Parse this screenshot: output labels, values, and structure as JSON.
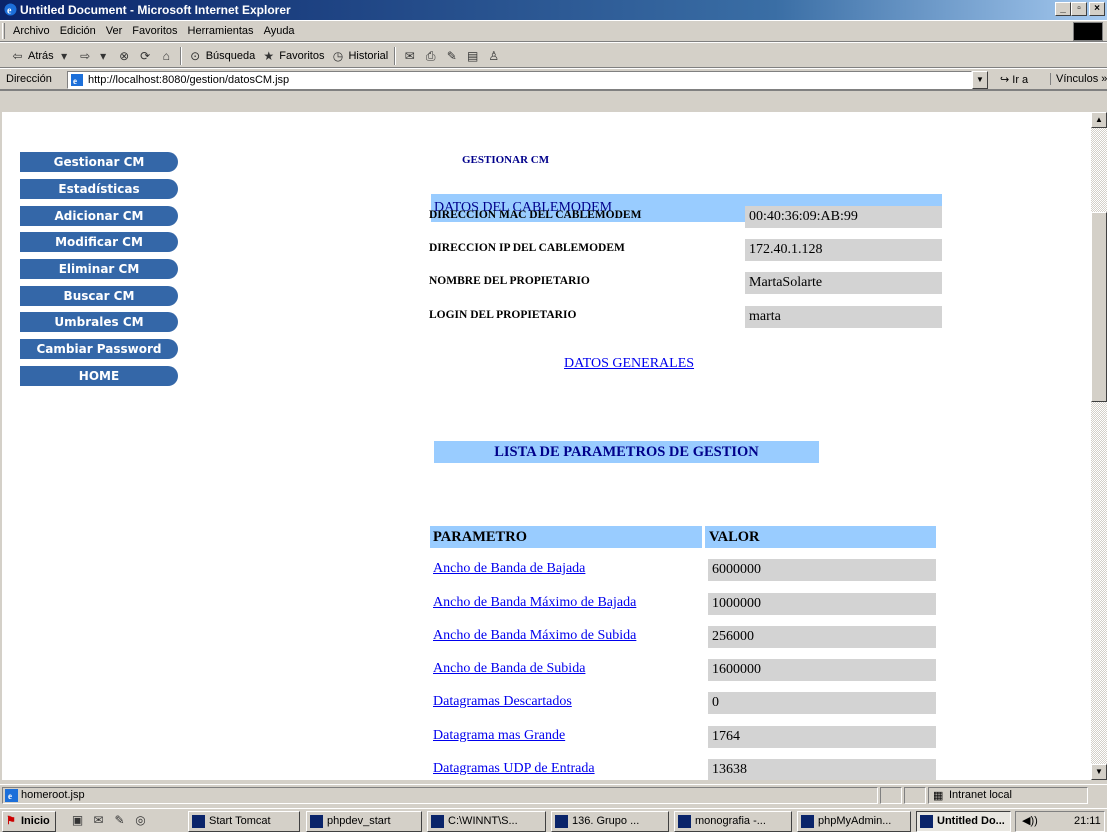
{
  "window": {
    "title": "Untitled Document - Microsoft Internet Explorer",
    "min": "_",
    "max": "á",
    "close": "×"
  },
  "menu": [
    "Archivo",
    "Edición",
    "Ver",
    "Favoritos",
    "Herramientas",
    "Ayuda"
  ],
  "toolbar": {
    "back": "Atrás",
    "search": "Búsqueda",
    "favorites": "Favoritos",
    "history": "Historial"
  },
  "address": {
    "label": "Dirección",
    "url": "http://localhost:8080/gestion/datosCM.jsp",
    "go": "Ir a",
    "links": "Vínculos"
  },
  "page": {
    "heading": "GESTIONAR CM",
    "nav": [
      "Gestionar CM",
      "Estadísticas",
      "Adicionar CM",
      "Modificar CM",
      "Eliminar CM",
      "Buscar CM",
      "Umbrales CM",
      "Cambiar Password",
      "HOME"
    ],
    "datos_title": "DATOS DEL CABLEMODEM",
    "datos": [
      {
        "label": "DIRECCION MAC DEL CABLEMODEM",
        "value": "00:40:36:09:AB:99"
      },
      {
        "label": "DIRECCION IP DEL CABLEMODEM",
        "value": "172.40.1.128"
      },
      {
        "label": "NOMBRE DEL PROPIETARIO",
        "value": "MartaSolarte"
      },
      {
        "label": "LOGIN DEL PROPIETARIO",
        "value": "marta"
      }
    ],
    "datos_link": "DATOS GENERALES",
    "lista_title": "LISTA DE PARAMETROS DE GESTION",
    "table_headers": [
      "PARAMETRO",
      "VALOR"
    ],
    "params": [
      {
        "name": "Ancho de Banda de Bajada",
        "value": "6000000"
      },
      {
        "name": "Ancho de Banda Máximo de Bajada",
        "value": "1000000"
      },
      {
        "name": "Ancho de Banda Máximo de Subida",
        "value": "256000"
      },
      {
        "name": "Ancho de Banda de Subida",
        "value": "1600000"
      },
      {
        "name": "Datagramas Descartados",
        "value": "0"
      },
      {
        "name": "Datagrama mas Grande",
        "value": "1764"
      },
      {
        "name": "Datagramas UDP de Entrada",
        "value": "13638"
      }
    ]
  },
  "status": {
    "text": "homeroot.jsp",
    "zone": "Intranet local"
  },
  "taskbar": {
    "start": "Inicio",
    "tasks": [
      "Start Tomcat",
      "phpdev_start",
      "C:\\WINNT\\S...",
      "136. Grupo ...",
      "monografia -...",
      "phpMyAdmin...",
      "Untitled Do..."
    ],
    "clock": "21:11"
  }
}
